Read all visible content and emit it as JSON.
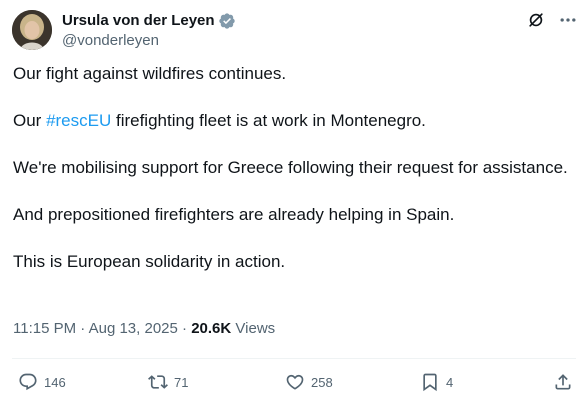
{
  "author": {
    "display_name": "Ursula von der Leyen",
    "handle": "@vonderleyen",
    "verified": true,
    "verified_color": "#829aab"
  },
  "top_icons": [
    "grok-icon",
    "more-icon"
  ],
  "tweet": {
    "paragraphs": [
      "Our fight against wildfires continues.",
      {
        "before": "Our ",
        "hashtag": "#rescEU",
        "after": " firefighting fleet is at work in Montenegro."
      },
      "We're mobilising support for Greece following their request for assistance.",
      "And prepositioned firefighters are already helping in Spain.",
      "This is European solidarity in action."
    ]
  },
  "meta": {
    "time": "11:15 PM",
    "separator": "·",
    "date": "Aug 13, 2025",
    "views_count": "20.6K",
    "views_label": "Views"
  },
  "actions": {
    "replies": "146",
    "reposts": "71",
    "likes": "258",
    "bookmarks": "4"
  },
  "colors": {
    "text": "#0f1419",
    "secondary": "#536471",
    "link": "#1d9bf0",
    "divider": "#eff3f4"
  }
}
